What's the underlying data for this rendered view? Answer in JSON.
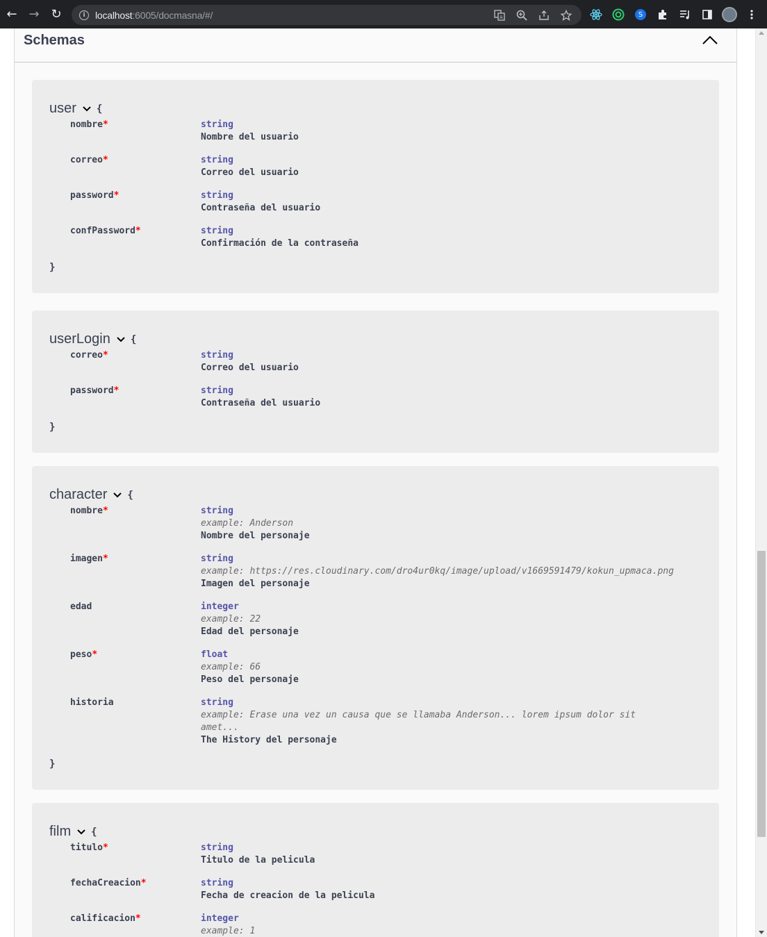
{
  "browser": {
    "url_host": "localhost",
    "url_rest": ":6005/docmasna/#/",
    "icons": [
      "back-icon",
      "forward-icon",
      "reload-icon",
      "info-icon",
      "translate-icon",
      "zoom-icon",
      "share-icon",
      "star-icon",
      "react-devtools-icon",
      "extension-green-icon",
      "extension-blue-icon",
      "puzzle-icon",
      "media-icon",
      "sidepanel-icon",
      "avatar",
      "menu-icon"
    ]
  },
  "schemas": {
    "title": "Schemas",
    "models": [
      {
        "name": "user",
        "properties": [
          {
            "name": "nombre",
            "required": "*",
            "type": "string",
            "description": "Nombre del usuario"
          },
          {
            "name": "correo",
            "required": "*",
            "type": "string",
            "description": "Correo del usuario"
          },
          {
            "name": "password",
            "required": "*",
            "type": "string",
            "description": "Contraseña del usuario"
          },
          {
            "name": "confPassword",
            "required": "*",
            "type": "string",
            "description": "Confirmación de la contraseña"
          }
        ]
      },
      {
        "name": "userLogin",
        "properties": [
          {
            "name": "correo",
            "required": "*",
            "type": "string",
            "description": "Correo del usuario"
          },
          {
            "name": "password",
            "required": "*",
            "type": "string",
            "description": "Contraseña del usuario"
          }
        ]
      },
      {
        "name": "character",
        "properties": [
          {
            "name": "nombre",
            "required": "*",
            "type": "string",
            "example": "example: Anderson",
            "description": "Nombre del personaje"
          },
          {
            "name": "imagen",
            "required": "*",
            "type": "string",
            "example": "example: https://res.cloudinary.com/dro4ur0kq/image/upload/v1669591479/kokun_upmaca.png",
            "description": "Imagen del personaje"
          },
          {
            "name": "edad",
            "required": "",
            "type": "integer",
            "example": "example: 22",
            "description": "Edad del personaje"
          },
          {
            "name": "peso",
            "required": "*",
            "type": "float",
            "example": "example: 66",
            "description": "Peso del personaje"
          },
          {
            "name": "historia",
            "required": "",
            "type": "string",
            "example": "example: Erase una vez un causa que se llamaba Anderson... lorem ipsum dolor sit",
            "example2": "amet...",
            "description": "The History del personaje"
          }
        ]
      },
      {
        "name": "film",
        "properties": [
          {
            "name": "titulo",
            "required": "*",
            "type": "string",
            "description": "Titulo de la pelicula"
          },
          {
            "name": "fechaCreacion",
            "required": "*",
            "type": "string",
            "description": "Fecha de creacion de la pelicula"
          },
          {
            "name": "calificacion",
            "required": "*",
            "type": "integer",
            "example": "example: 1"
          }
        ]
      }
    ],
    "brace_open": "{",
    "brace_close": "}"
  }
}
